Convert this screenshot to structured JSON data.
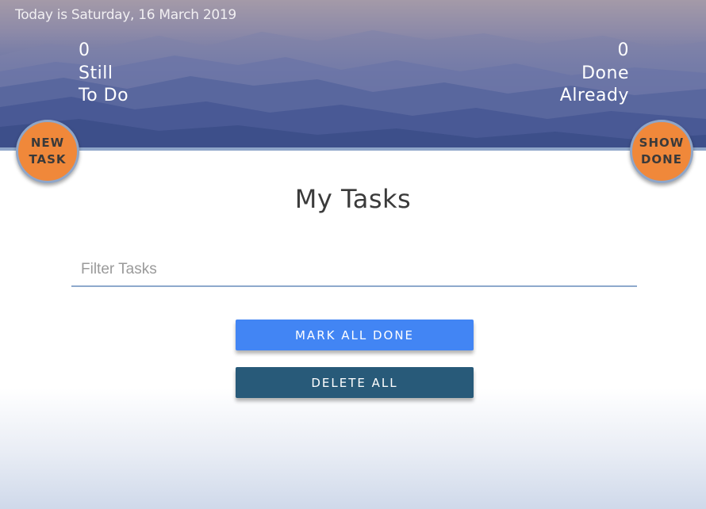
{
  "header": {
    "date_text": "Today is Saturday, 16 March 2019",
    "todo": {
      "count": "0",
      "line1": "Still",
      "line2": "To Do"
    },
    "done": {
      "count": "0",
      "line1": "Done",
      "line2": "Already"
    }
  },
  "fab_new": {
    "line1": "NEW",
    "line2": "TASK"
  },
  "fab_show": {
    "line1": "SHOW",
    "line2": "DONE"
  },
  "main": {
    "title": "My Tasks",
    "filter": {
      "placeholder": "Filter Tasks",
      "value": ""
    },
    "mark_all_label": "MARK ALL DONE",
    "delete_all_label": "DELETE ALL"
  },
  "colors": {
    "accent_orange": "#f0883a",
    "primary_blue": "#4285f4",
    "dark_blue": "#285a79"
  }
}
